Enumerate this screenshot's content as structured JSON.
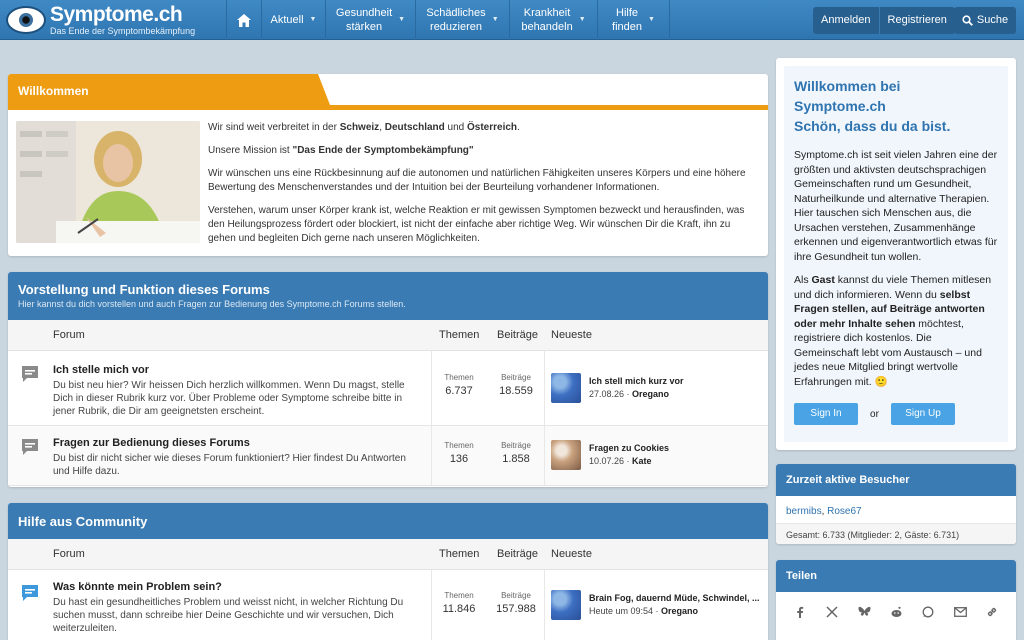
{
  "header": {
    "logo_name": "Symptome.ch",
    "logo_tagline": "Das Ende der Symptombekämpfung",
    "nav": [
      {
        "line1": "Aktuell",
        "line2": ""
      },
      {
        "line1": "Gesundheit",
        "line2": "stärken"
      },
      {
        "line1": "Schädliches",
        "line2": "reduzieren"
      },
      {
        "line1": "Krankheit",
        "line2": "behandeln"
      },
      {
        "line1": "Hilfe",
        "line2": "finden"
      }
    ],
    "login_label": "Anmelden",
    "register_label": "Registrieren",
    "search_label": "Suche"
  },
  "welcome": {
    "tab_label": "Willkommen",
    "p1_a": "Wir sind weit verbreitet in der ",
    "p1_b": "Schweiz",
    "p1_c": ", ",
    "p1_d": "Deutschland",
    "p1_e": " und ",
    "p1_f": "Österreich",
    "p1_g": ".",
    "p2_a": "Unsere Mission ist ",
    "p2_b": "\"Das Ende der Symptombekämpfung\"",
    "p3": "Wir wünschen uns eine Rückbesinnung auf die autonomen und natürlichen Fähigkeiten unseres Körpers und eine höhere Bewertung des Menschenverstandes und der Intuition bei der Beurteilung vorhandener Informationen.",
    "p4": "Verstehen, warum unser Körper krank ist, welche Reaktion er mit gewissen Symptomen bezweckt und herausfinden, was den Heilungsprozess fördert oder blockiert, ist nicht der einfache aber richtige Weg. Wir wünschen Dir die Kraft, ihn zu gehen und begleiten Dich gerne nach unseren Möglichkeiten."
  },
  "columns": {
    "forum": "Forum",
    "themen": "Themen",
    "beitraege": "Beiträge",
    "neueste": "Neueste"
  },
  "stat_labels": {
    "themen": "Themen",
    "beitraege": "Beiträge"
  },
  "block1": {
    "title": "Vorstellung und Funktion dieses Forums",
    "desc": "Hier kannst du dich vorstellen und auch Fragen zur Bedienung des Symptome.ch Forums stellen.",
    "rows": [
      {
        "title": "Ich stelle mich vor",
        "desc": "Du bist neu hier? Wir heissen Dich herzlich willkommen. Wenn Du magst, stelle Dich in dieser Rubrik kurz vor. Über Probleme oder Symptome schreibe bitte in jener Rubrik, die Dir am geeignetsten erscheint.",
        "themen": "6.737",
        "beitraege": "18.559",
        "latest_title": "Ich stell mich kurz vor",
        "latest_date": "27.08.26",
        "latest_user": "Oregano"
      },
      {
        "title": "Fragen zur Bedienung dieses Forums",
        "desc": "Du bist dir nicht sicher wie dieses Forum funktioniert? Hier findest Du Antworten und Hilfe dazu.",
        "themen": "136",
        "beitraege": "1.858",
        "latest_title": "Fragen zu Cookies",
        "latest_date": "10.07.26",
        "latest_user": "Kate"
      }
    ]
  },
  "block2": {
    "title": "Hilfe aus Community",
    "rows": [
      {
        "title": "Was könnte mein Problem sein?",
        "desc": "Du hast ein gesundheitliches Problem und weisst nicht, in welcher Richtung Du suchen musst, dann schreibe hier Deine Geschichte und wir versuchen, Dich weiterzuleiten.",
        "themen": "11.846",
        "beitraege": "157.988",
        "latest_title": "Brain Fog, dauernd Müde, Schwindel, ...",
        "latest_date": "Heute um 09:54",
        "latest_user": "Oregano"
      }
    ]
  },
  "sidebar": {
    "welcome_title_1": "Willkommen bei",
    "welcome_title_2": "Symptome.ch",
    "welcome_title_3": "Schön, dass du da bist.",
    "welcome_p1": "Symptome.ch ist seit vielen Jahren eine der größten und aktivsten deutschsprachigen Gemeinschaften rund um Gesundheit, Naturheilkunde und alternative Therapien. Hier tauschen sich Menschen aus, die Ursachen verstehen, Zusammenhänge erkennen und eigenverantwortlich etwas für ihre Gesundheit tun wollen.",
    "welcome_p2_a": "Als ",
    "welcome_p2_b": "Gast",
    "welcome_p2_c": " kannst du viele Themen mitlesen und dich informieren. Wenn du ",
    "welcome_p2_d": "selbst Fragen stellen, auf Beiträge antworten oder mehr Inhalte sehen",
    "welcome_p2_e": " möchtest, registriere dich kostenlos. Die Gemeinschaft lebt vom Austausch – und jedes neue Mitglied bringt wertvolle Erfahrungen mit. 🙂",
    "signin_label": "Sign In",
    "or_label": "or",
    "signup_label": "Sign Up",
    "visitors_title": "Zurzeit aktive Besucher",
    "visitors": [
      "bermibs",
      "Rose67"
    ],
    "visitors_total": "Gesamt: 6.733 (Mitglieder: 2, Gäste: 6.731)",
    "share_title": "Teilen",
    "share_icons": [
      "facebook-icon",
      "x-icon",
      "bluesky-icon",
      "reddit-icon",
      "whatsapp-icon",
      "email-icon",
      "link-icon"
    ]
  },
  "colors": {
    "brand_blue": "#3a7bb3",
    "accent_orange": "#ee9c12",
    "button_blue": "#49a3e4"
  }
}
